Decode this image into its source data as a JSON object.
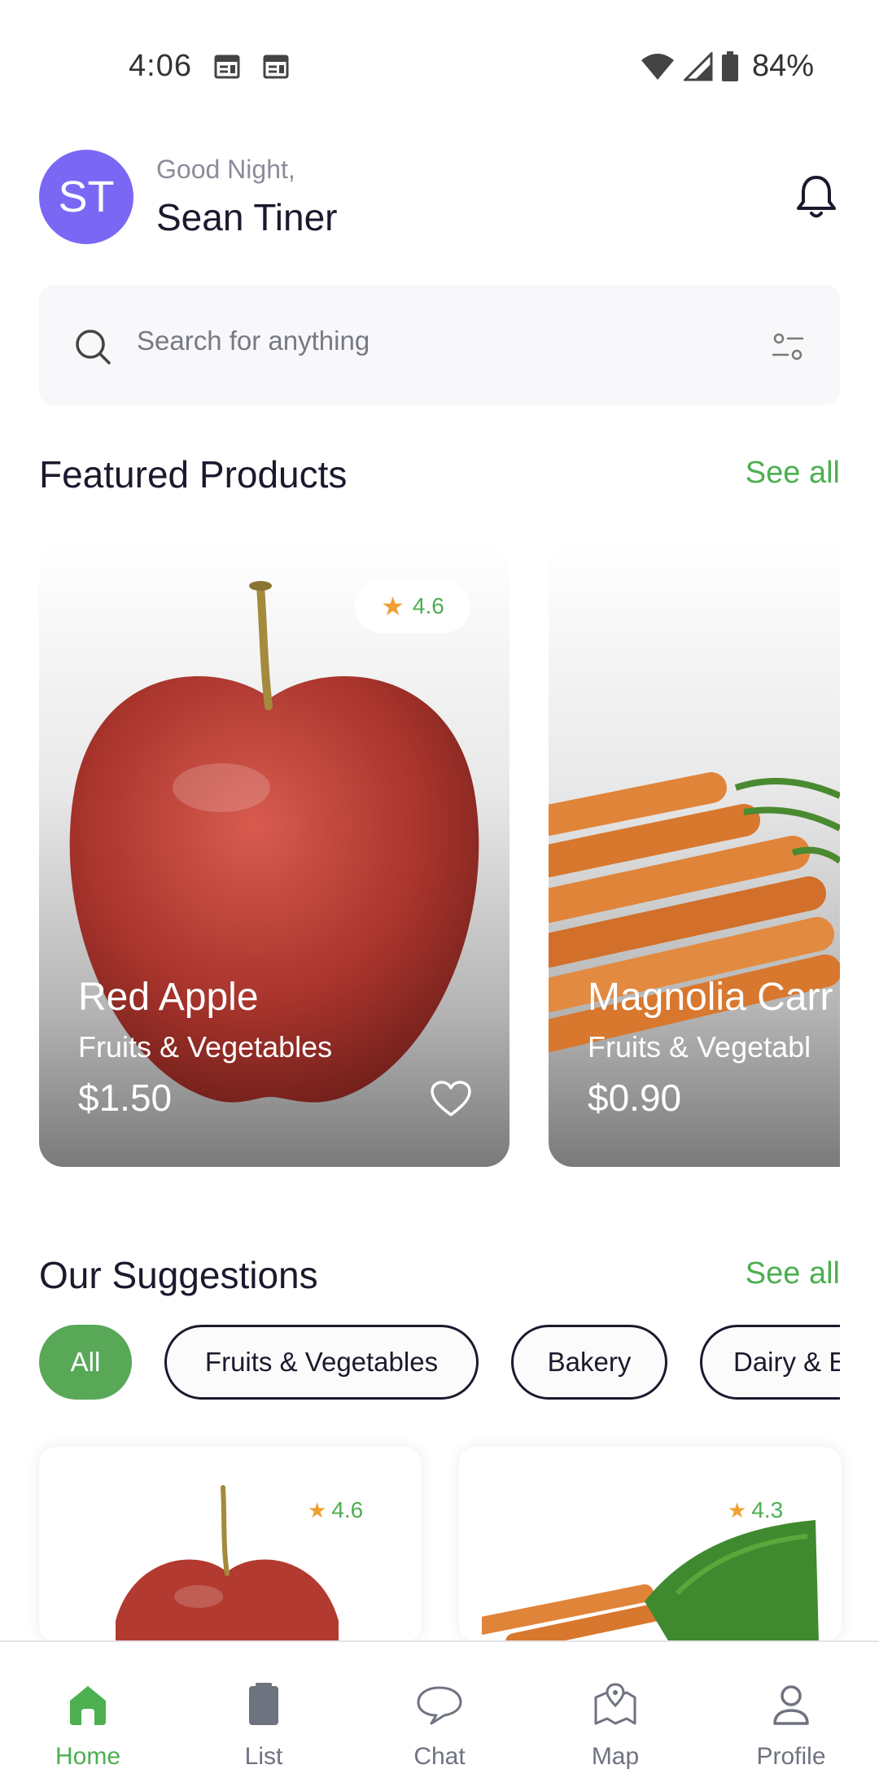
{
  "status_bar": {
    "time": "4:06",
    "battery": "84%"
  },
  "header": {
    "avatar_initials": "ST",
    "greeting": "Good Night,",
    "name": "Sean Tiner"
  },
  "search": {
    "placeholder": "Search for anything"
  },
  "featured": {
    "title": "Featured Products",
    "see_all": "See all",
    "products": [
      {
        "name": "Red Apple",
        "category": "Fruits & Vegetables",
        "price": "$1.50",
        "rating": "4.6"
      },
      {
        "name": "Magnolia Carr",
        "category": "Fruits & Vegetabl",
        "price": "$0.90"
      }
    ]
  },
  "suggestions": {
    "title": "Our Suggestions",
    "see_all": "See all",
    "chips": [
      "All",
      "Fruits & Vegetables",
      "Bakery",
      "Dairy & E"
    ],
    "active_chip": "All",
    "cards": [
      {
        "rating": "4.6"
      },
      {
        "rating": "4.3"
      }
    ]
  },
  "nav": {
    "items": [
      {
        "label": "Home",
        "icon": "home-icon",
        "active": true
      },
      {
        "label": "List",
        "icon": "clipboard-icon",
        "active": false
      },
      {
        "label": "Chat",
        "icon": "chat-bubble-icon",
        "active": false
      },
      {
        "label": "Map",
        "icon": "map-icon",
        "active": false
      },
      {
        "label": "Profile",
        "icon": "profile-icon",
        "active": false
      }
    ]
  },
  "colors": {
    "accent": "#4caf50",
    "avatar": "#7a68f5",
    "star": "#f0a030",
    "text": "#1a1a2e"
  }
}
